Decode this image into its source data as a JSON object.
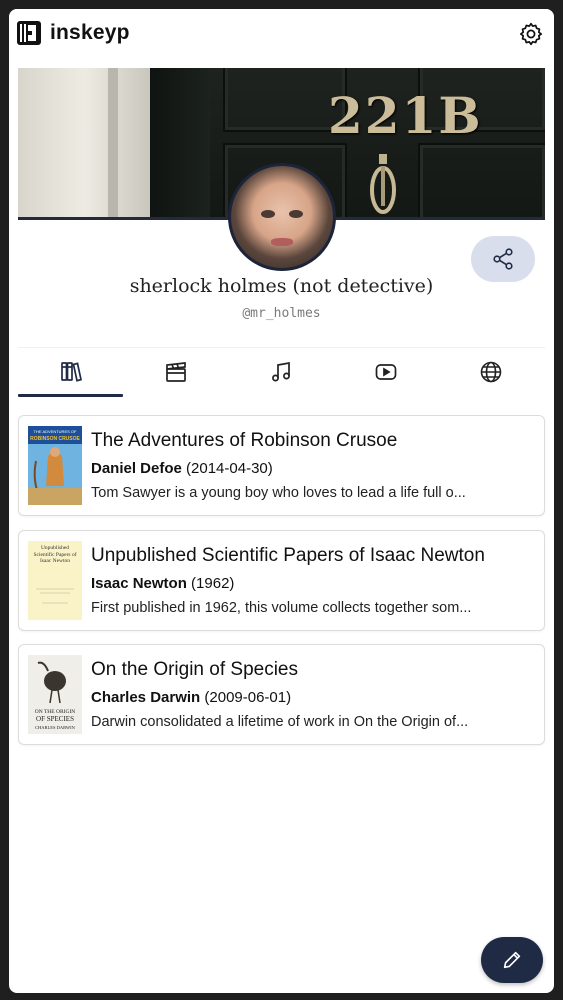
{
  "app": {
    "title": "inskeyp"
  },
  "banner": {
    "door_number": "221B"
  },
  "profile": {
    "name": "sherlock holmes (not detective)",
    "handle": "@mr_holmes"
  },
  "tabs": [
    {
      "icon": "books-icon",
      "active": true
    },
    {
      "icon": "clapperboard-icon",
      "active": false
    },
    {
      "icon": "music-note-icon",
      "active": false
    },
    {
      "icon": "youtube-icon",
      "active": false
    },
    {
      "icon": "globe-icon",
      "active": false
    }
  ],
  "books": [
    {
      "title": "The Adventures of Robinson Crusoe",
      "author": "Daniel Defoe",
      "date": "(2014-04-30)",
      "description": "Tom Sawyer is a young boy who loves to lead a life full o..."
    },
    {
      "title": "Unpublished Scientific Papers of Isaac Newton",
      "author": "Isaac Newton",
      "date": "(1962)",
      "description": "First published in 1962, this volume collects together som..."
    },
    {
      "title": "On the Origin of Species",
      "author": "Charles Darwin",
      "date": "(2009-06-01)",
      "description": "Darwin consolidated a lifetime of work in On the Origin of..."
    }
  ],
  "covers": {
    "crusoe": {
      "top_text": "THE ADVENTURES OF",
      "main_text": "ROBINSON CRUSOE"
    },
    "newton": {
      "title_text": "Unpublished Scientific Papers of Isaac Newton"
    },
    "darwin": {
      "title_line1": "ON THE ORIGIN",
      "title_line2": "OF SPECIES",
      "author_line": "CHARLES DARWIN"
    }
  },
  "colors": {
    "accent": "#1f2a44",
    "share_bg": "#d9deec",
    "page_bg": "#ffffff"
  }
}
